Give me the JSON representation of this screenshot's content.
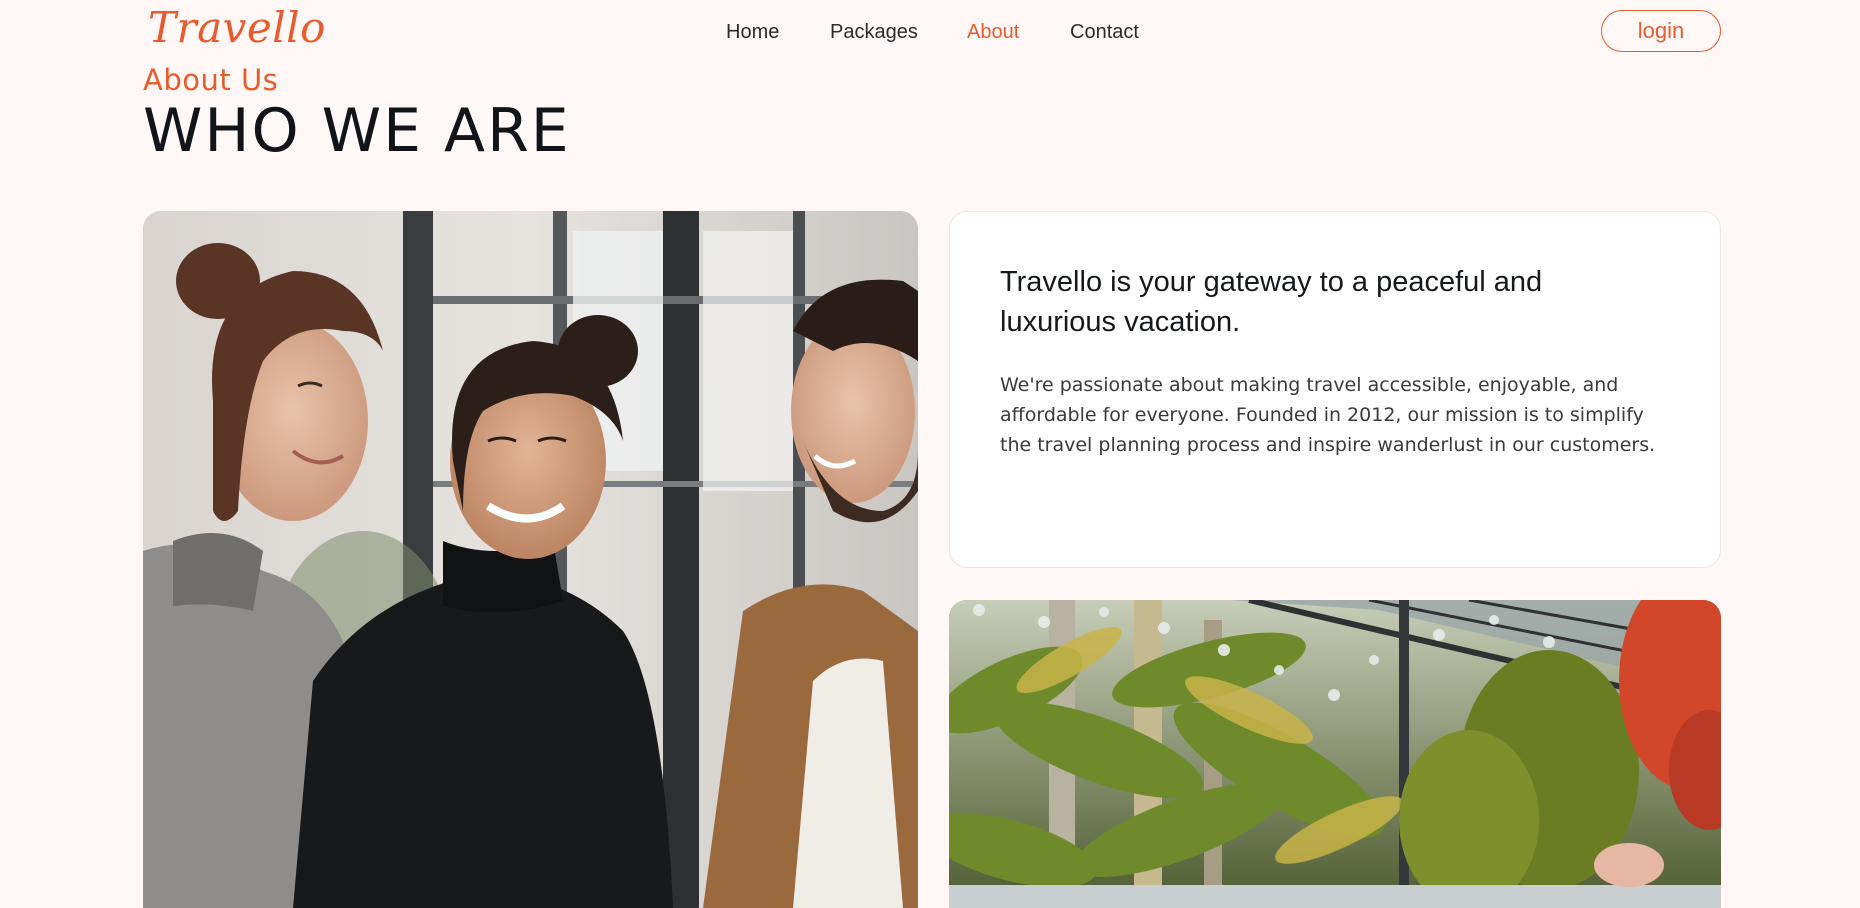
{
  "brand": {
    "logo_text": "Travello",
    "accent_color": "#e95b2c"
  },
  "nav": {
    "items": [
      {
        "label": "Home"
      },
      {
        "label": "Packages"
      },
      {
        "label": "About"
      },
      {
        "label": "Contact"
      }
    ],
    "active": "About"
  },
  "header": {
    "login_label": "login"
  },
  "hero": {
    "eyebrow": "About Us",
    "title": "WHO WE ARE"
  },
  "card": {
    "title": "Travello is your gateway to a peaceful and luxurious vacation.",
    "body": "We're passionate about making travel accessible, enjoyable, and affordable for everyone. Founded in 2012, our mission is to simplify the travel planning process and inspire wanderlust in our customers."
  },
  "images": {
    "left": "team-photo",
    "right": "tropical-garden-photo"
  }
}
